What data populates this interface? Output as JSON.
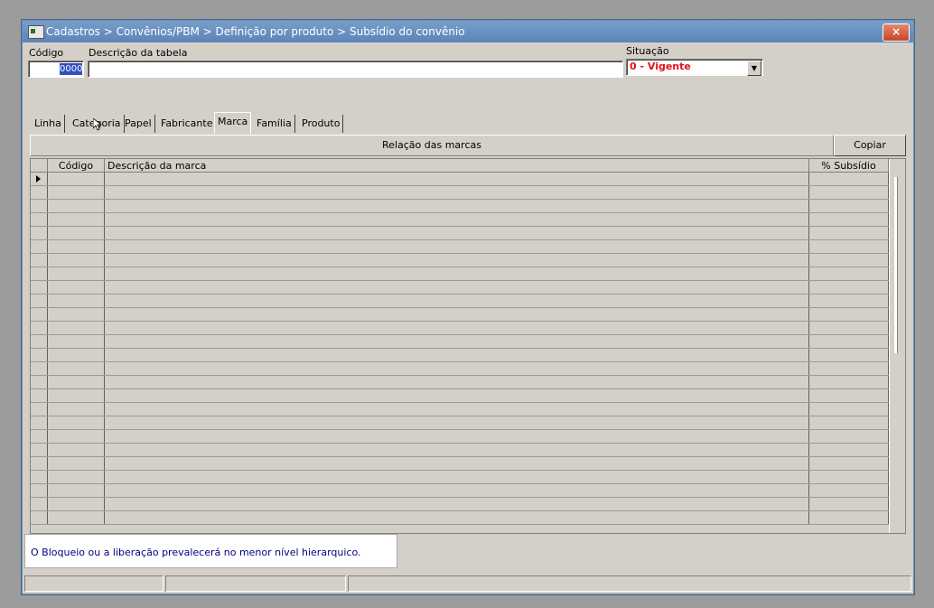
{
  "window": {
    "title": "Cadastros > Convênios/PBM > Definição por produto > Subsídio do convênio",
    "close_label": "×"
  },
  "form": {
    "code_label": "Código",
    "code_value": "0000",
    "description_label": "Descrição da tabela",
    "description_value": "",
    "status_label": "Situação",
    "status_value": "0 - Vigente"
  },
  "tabs": [
    {
      "label": "Linha"
    },
    {
      "label": "Categoria"
    },
    {
      "label": "Papel"
    },
    {
      "label": "Fabricante"
    },
    {
      "label": "Marca",
      "active": true
    },
    {
      "label": "Família"
    },
    {
      "label": "Produto"
    }
  ],
  "panel": {
    "header": "Relação das marcas",
    "copy_button": "Copiar"
  },
  "grid": {
    "columns": [
      "Código",
      "Descrição da marca",
      "% Subsídio"
    ],
    "row_count": 26
  },
  "info": {
    "message": "O Bloqueio ou a liberação prevalecerá no menor nível hierarquico."
  },
  "colors": {
    "status_text": "#e0101a",
    "info_text": "#000080"
  }
}
